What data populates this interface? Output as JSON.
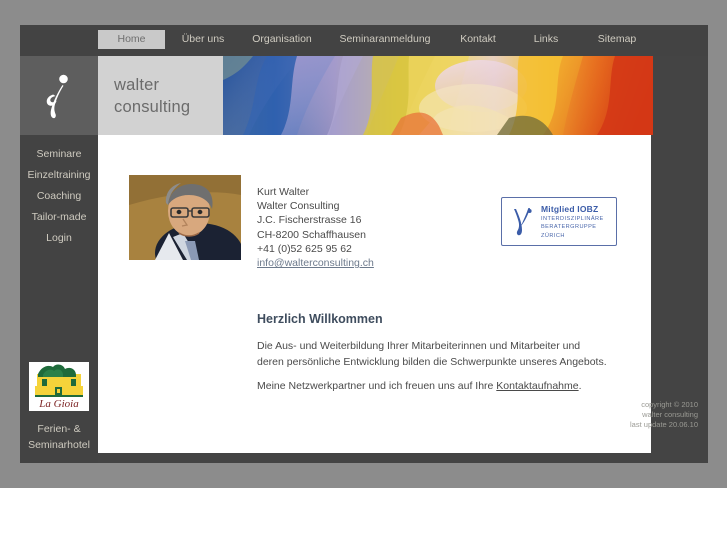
{
  "site": {
    "logo_line1": "walter",
    "logo_line2": "consulting"
  },
  "topnav": {
    "items": [
      {
        "label": "Home",
        "active": true
      },
      {
        "label": "Über uns",
        "active": false
      },
      {
        "label": "Organisation",
        "active": false
      },
      {
        "label": "Seminaranmeldung",
        "active": false
      },
      {
        "label": "Kontakt",
        "active": false
      },
      {
        "label": "Links",
        "active": false
      },
      {
        "label": "Sitemap",
        "active": false
      }
    ]
  },
  "sidebar": {
    "items": [
      {
        "label": "Seminare"
      },
      {
        "label": "Einzeltraining"
      },
      {
        "label": "Coaching"
      },
      {
        "label": "Tailor-made"
      },
      {
        "label": "Login"
      }
    ],
    "lagioia": {
      "brand": "La Gioia",
      "caption_line1": "Ferien- &",
      "caption_line2": "Seminarhotel"
    }
  },
  "contact": {
    "name": "Kurt Walter",
    "company": "Walter Consulting",
    "street": "J.C. Fischerstrasse 16",
    "city": "CH-8200 Schaffhausen",
    "phone": "+41 (0)52 625 95 62",
    "email": "info@walterconsulting.ch"
  },
  "badge": {
    "title": "Mitglied IOBZ",
    "sub1": "Interdisziplinäre",
    "sub2": "Beratergruppe",
    "sub3": "Zürich"
  },
  "main": {
    "heading": "Herzlich Willkommen",
    "paragraph1_line1": "Die Aus- und Weiterbildung Ihrer Mitarbeiterinnen und Mitarbeiter und",
    "paragraph1_line2": "deren persönliche Entwicklung bilden die Schwerpunkte unseres Angebots.",
    "paragraph2_prefix": "Meine Netzwerkpartner und ich freuen uns auf Ihre ",
    "paragraph2_link": "Kontaktaufnahme",
    "paragraph2_suffix": "."
  },
  "footer": {
    "copyright": "copyright © 2010",
    "company": "walter consulting",
    "last_update": "last update 20.06.10"
  },
  "colors": {
    "page_background": "#8c8c8c",
    "frame_dark": "#444444",
    "nav_dark": "#434343",
    "nav_text": "#cfcbc0",
    "nav_active_bg": "#c9c9c9",
    "logo_panel": "#d2d2d2",
    "content_white": "#ffffff",
    "heading_blue": "#3f4d5e",
    "badge_blue": "#3b5ca8"
  }
}
